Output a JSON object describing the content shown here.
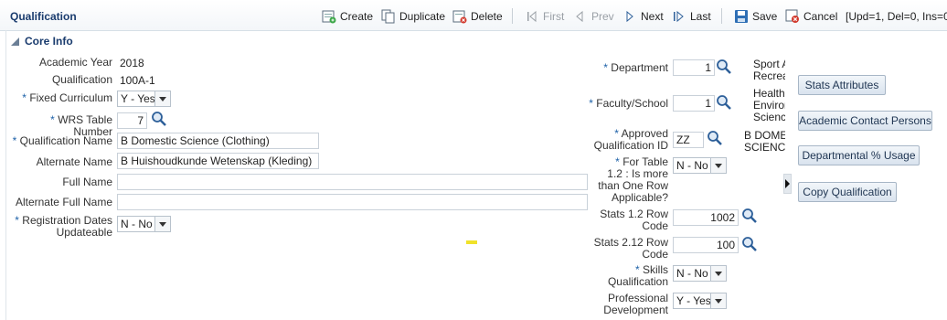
{
  "header": {
    "title": "Qualification",
    "toolbar": {
      "create": "Create",
      "duplicate": "Duplicate",
      "delete": "Delete",
      "first": "First",
      "prev": "Prev",
      "next": "Next",
      "last": "Last",
      "save": "Save",
      "cancel": "Cancel"
    },
    "status": "[Upd=1, Del=0, Ins=0"
  },
  "section": {
    "title": "Core Info"
  },
  "form_left": {
    "academic_year": {
      "label": "Academic Year",
      "value": "2018"
    },
    "qualification": {
      "label": "Qualification",
      "value": "100A-1"
    },
    "fixed_curriculum": {
      "label": "Fixed Curriculum",
      "value": "Y - Yes"
    },
    "wrs_table_number": {
      "label": "WRS Table Number",
      "value": "7"
    },
    "qualification_name": {
      "label": "Qualification Name",
      "value": "B Domestic Science (Clothing)"
    },
    "alternate_name": {
      "label": "Alternate Name",
      "value": "B Huishoudkunde Wetenskap (Kleding)"
    },
    "full_name": {
      "label": "Full Name",
      "value": ""
    },
    "alternate_full_name": {
      "label": "Alternate Full Name",
      "value": ""
    },
    "registration_dates": {
      "label_line1": "Registration Dates",
      "label_line2": "Updateable",
      "value": "N - No"
    }
  },
  "form_right": {
    "department": {
      "label": "Department",
      "value": "1",
      "desc_line1": "Sport A",
      "desc_line2": "Recreat"
    },
    "faculty": {
      "label": "Faculty/School",
      "value": "1",
      "desc_line1": "Health",
      "desc_line2": "Environ",
      "desc_line3": "Science"
    },
    "approved_qualification": {
      "label_line1": "Approved",
      "label_line2": "Qualification ID",
      "value": "ZZ",
      "desc_line1": "B DOMES",
      "desc_line2": "SCIENCE"
    },
    "for_table": {
      "label_line1": "For Table",
      "label_line2": "1.2 : Is more",
      "label_line3": "than One Row",
      "label_line4": "Applicable?",
      "value": "N - No"
    },
    "stats_12": {
      "label_line1": "Stats 1.2 Row",
      "label_line2": "Code",
      "value": "1002"
    },
    "stats_212": {
      "label_line1": "Stats 2.12 Row",
      "label_line2": "Code",
      "value": "100"
    },
    "skills": {
      "label_line1": "Skills",
      "label_line2": "Qualification",
      "value": "N - No"
    },
    "professional": {
      "label_line1": "Professional",
      "label_line2": "Development",
      "value": "Y - Yes"
    }
  },
  "side_buttons": {
    "stats_attributes": "Stats Attributes",
    "academic_contact_persons": "Academic Contact Persons",
    "departmental_usage": "Departmental % Usage",
    "copy_qualification": "Copy Qualification"
  },
  "required_marker": "*",
  "colors": {
    "title": "#1a3c6e",
    "required": "#1d61a8",
    "highlight": "#f0e22a"
  }
}
